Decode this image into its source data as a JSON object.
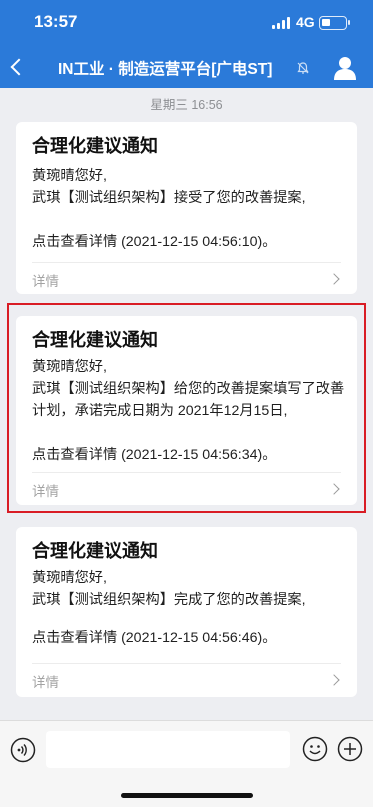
{
  "status_bar": {
    "time": "13:57",
    "network": "4G"
  },
  "nav": {
    "title": "IN工业 · 制造运营平台[广电ST]",
    "mute_icon": "bell-slash-icon",
    "profile_icon": "person-icon"
  },
  "chat": {
    "timestamp": "星期三 16:56",
    "messages": [
      {
        "title": "合理化建议通知",
        "lines": [
          "黄琬晴您好,",
          "武琪【测试组织架构】接受了您的改善提案,",
          "点击查看详情 (2021-12-15 04:56:10)。"
        ],
        "footer": "详情"
      },
      {
        "title": "合理化建议通知",
        "lines": [
          "黄琬晴您好,",
          "武琪【测试组织架构】给您的改善提案填写了改善计划，承诺完成日期为 2021年12月15日,",
          "点击查看详情 (2021-12-15 04:56:34)。"
        ],
        "footer": "详情"
      },
      {
        "title": "合理化建议通知",
        "lines": [
          "黄琬晴您好,",
          "武琪【测试组织架构】完成了您的改善提案,",
          "点击查看详情 (2021-12-15 04:56:46)。"
        ],
        "footer": "详情"
      }
    ]
  },
  "input_bar": {
    "voice_icon": "voice-icon",
    "emoji_icon": "emoji-icon",
    "plus_icon": "plus-icon",
    "placeholder": ""
  },
  "colors": {
    "header": "#2b7ad9",
    "background": "#edeef2",
    "highlight": "#d91c25"
  }
}
